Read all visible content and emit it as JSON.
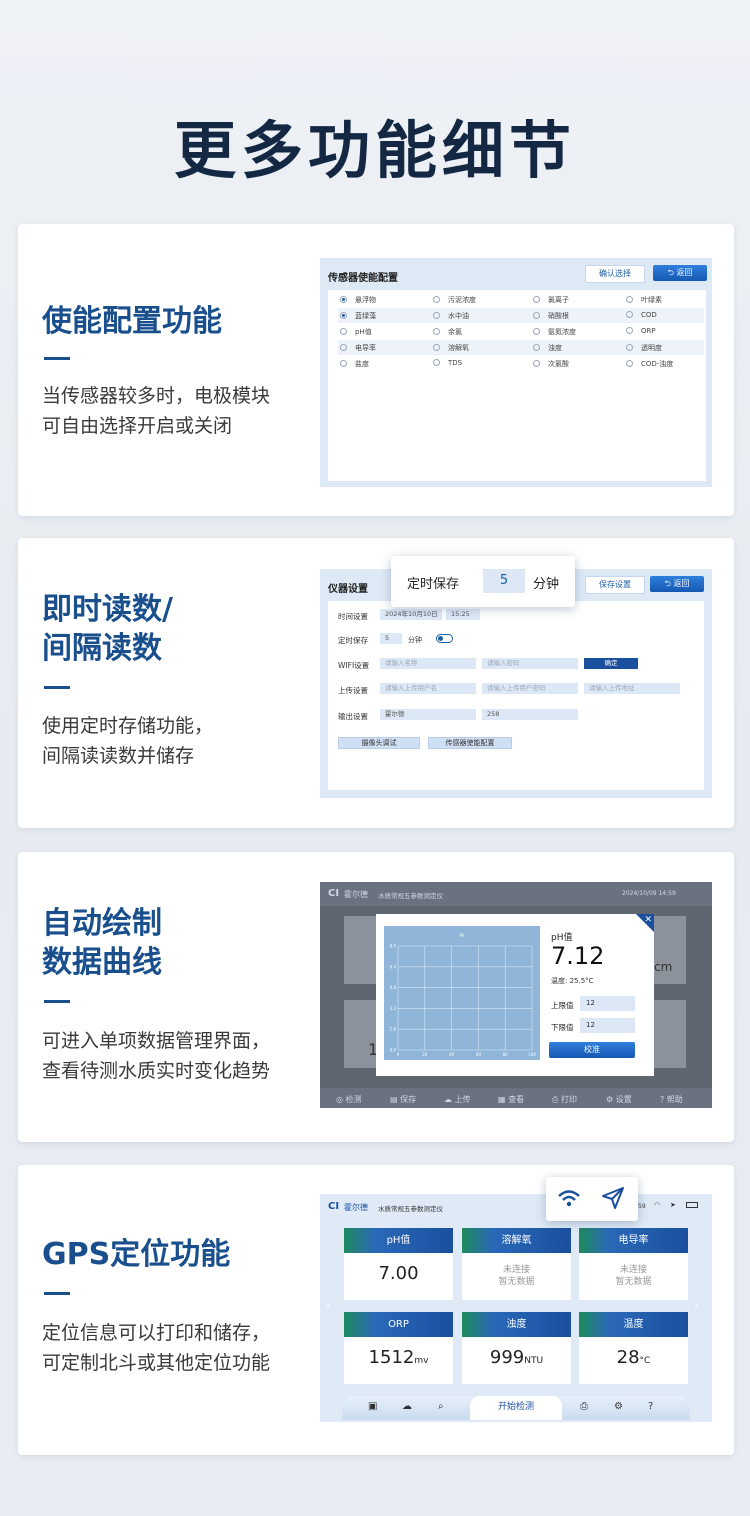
{
  "page_title": "更多功能细节",
  "cards": [
    {
      "title": "使能配置功能",
      "desc": [
        "当传感器较多时，电极模块",
        "可自由选择开启或关闭"
      ]
    },
    {
      "title": [
        "即时读数/",
        "间隔读数"
      ],
      "desc": [
        "使用定时存储功能，",
        "间隔读读数并储存"
      ]
    },
    {
      "title": [
        "自动绘制",
        "数据曲线"
      ],
      "desc": [
        "可进入单项数据管理界面，",
        "查看待测水质实时变化趋势"
      ]
    },
    {
      "title": "GPS定位功能",
      "desc": [
        "定位信息可以打印和储存，",
        "可定制北斗或其他定位功能"
      ]
    }
  ],
  "screen1": {
    "title": "传感器使能配置",
    "confirm": "确认选择",
    "back": "返回",
    "rows": [
      [
        "悬浮物",
        "污泥浓度",
        "氯离子",
        "叶绿素"
      ],
      [
        "蓝绿藻",
        "水中油",
        "硝酸根",
        "COD"
      ],
      [
        "pH值",
        "余氯",
        "氨氮浓度",
        "ORP"
      ],
      [
        "电导率",
        "溶解氧",
        "浊度",
        "透明度"
      ],
      [
        "盐度",
        "TDS",
        "次氯酸",
        "COD-浊度"
      ]
    ],
    "checked": [
      "悬浮物",
      "蓝绿藻"
    ]
  },
  "screen2": {
    "title": "仪器设置",
    "save": "保存设置",
    "back": "返回",
    "popup": {
      "label": "定时保存",
      "value": "5",
      "unit": "分钟"
    },
    "time_label": "时间设置",
    "date": "2024年10月10日",
    "time": "15:25",
    "timer_label": "定时保存",
    "timer_value": "5",
    "timer_unit": "分钟",
    "wifi_label": "WIFI设置",
    "wifi_name": "请输入名称",
    "wifi_pwd": "请输入密码",
    "ok": "确定",
    "upload_label": "上传设置",
    "up_user": "请输入上传用户名",
    "up_pwd": "请输入上传用户密码",
    "up_addr": "请输入上传地址",
    "output_label": "输出设置",
    "out1": "霍尔德",
    "out2": "258",
    "cam_btn": "摄像头调试",
    "sensor_btn": "传感器使能配置"
  },
  "screen3": {
    "brand": "霍尔德",
    "app_title": "水质常规五参数测定仪",
    "datetime": "2024/10/09  14:59",
    "chart_title": "Ph",
    "param": "pH值",
    "value": "7.12",
    "temp": "温度: 25.5°C",
    "upper_label": "上限值",
    "upper": "12",
    "lower_label": "下限值",
    "lower": "12",
    "calib": "校准",
    "bg_left": "1",
    "bg_right": "cm",
    "nav": [
      "检测",
      "保存",
      "上传",
      "查看",
      "打印",
      "设置",
      "帮助"
    ]
  },
  "chart_data": {
    "type": "line",
    "title": "Ph",
    "x": [],
    "y": [],
    "xticks": [
      "0",
      "20",
      "40",
      "60",
      "80",
      "100"
    ],
    "yticks": [
      "0.0",
      "1.6",
      "3.2",
      "4.8",
      "6.4",
      "8.0"
    ],
    "xlim": [
      0,
      100
    ],
    "ylim": [
      0,
      8
    ],
    "grid": true
  },
  "screen4": {
    "brand": "霍尔德",
    "app_title": "水质常规五参数测定仪",
    "time": "59",
    "tiles": [
      {
        "name": "pH值",
        "value": "7.00",
        "unit": ""
      },
      {
        "name": "溶解氧",
        "value": "未连接",
        "unit": "暂无数据"
      },
      {
        "name": "电导率",
        "value": "未连接",
        "unit": "暂无数据"
      },
      {
        "name": "ORP",
        "value": "1512",
        "unit": "mv"
      },
      {
        "name": "浊度",
        "value": "999",
        "unit": "NTU"
      },
      {
        "name": "温度",
        "value": "28",
        "unit": "°C"
      }
    ],
    "start": "开始检测"
  }
}
